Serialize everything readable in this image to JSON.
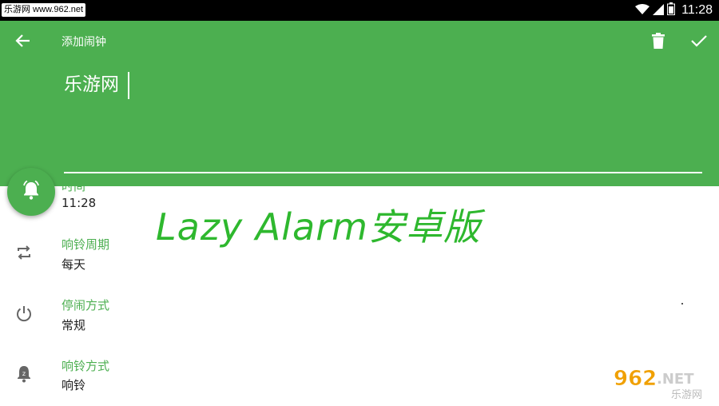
{
  "status_bar": {
    "watermark": "乐游网 www.962.net",
    "time": "11:28"
  },
  "appbar": {
    "title": "添加闹钟",
    "name_value": "乐游网"
  },
  "rows": [
    {
      "label": "时间",
      "value": "11:28",
      "icon": "alarm-bell-icon"
    },
    {
      "label": "响铃周期",
      "value": "每天",
      "icon": "repeat-icon"
    },
    {
      "label": "停闹方式",
      "value": "常规",
      "icon": "power-icon"
    },
    {
      "label": "响铃方式",
      "value": "响铃",
      "icon": "ring-bell-icon"
    }
  ],
  "promo_text": "Lazy Alarm安卓版",
  "logo": {
    "main": "962",
    "suffix": ".NET",
    "sub": "乐游网"
  },
  "colors": {
    "primary": "#4caf50",
    "promo": "#2eb82e"
  }
}
